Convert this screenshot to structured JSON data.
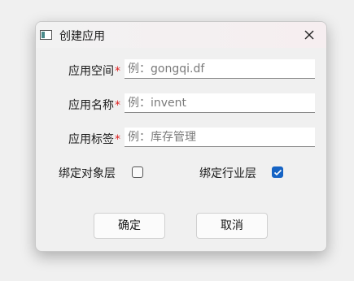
{
  "window": {
    "title": "创建应用",
    "close_icon": "close-icon",
    "app_icon": "window-app-icon"
  },
  "form": {
    "fields": [
      {
        "label": "应用空间",
        "required_mark": "*",
        "placeholder": "例：gongqi.df",
        "value": ""
      },
      {
        "label": "应用名称",
        "required_mark": "*",
        "placeholder": "例：invent",
        "value": ""
      },
      {
        "label": "应用标签",
        "required_mark": "*",
        "placeholder": "例：库存管理",
        "value": ""
      }
    ],
    "checkboxes": [
      {
        "label": "绑定对象层",
        "checked": false
      },
      {
        "label": "绑定行业层",
        "checked": true
      }
    ]
  },
  "buttons": {
    "ok": "确定",
    "cancel": "取消"
  },
  "colors": {
    "required": "#dd2222",
    "checkbox_checked": "#1563c4"
  }
}
